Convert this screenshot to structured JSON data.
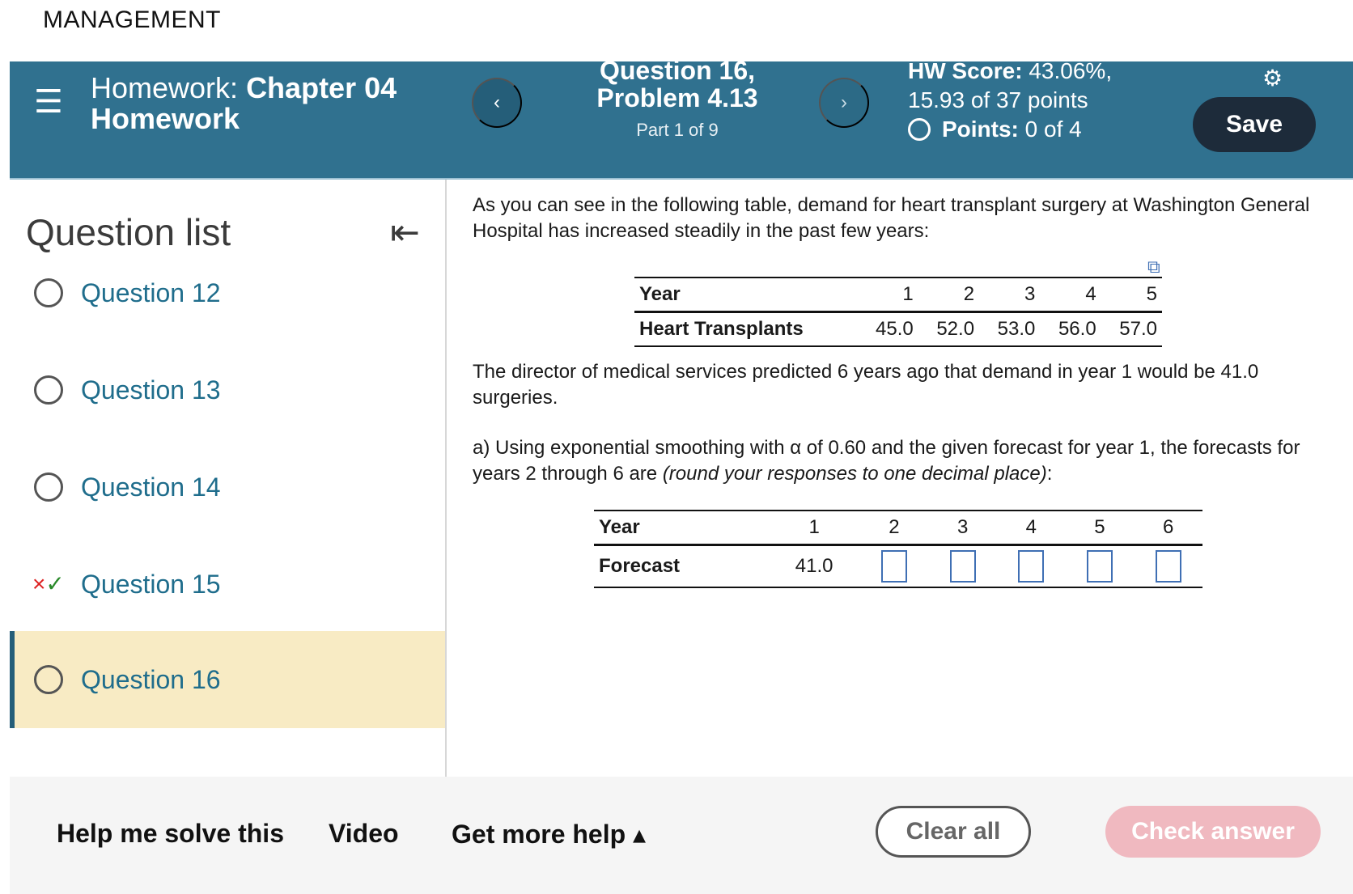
{
  "app": {
    "section_title": "MANAGEMENT"
  },
  "header": {
    "menu_icon": "hamburger-menu-icon",
    "hw_prefix": "Homework:",
    "hw_name_line1": "Chapter 04",
    "hw_name_line2": "Homework",
    "prev_label": "‹",
    "next_label": "›",
    "question_title_line1": "Question 16,",
    "question_title_line2": "Problem 4.13",
    "part": "Part 1 of 9",
    "hw_score_label": "HW Score:",
    "hw_score_value": "43.06%,",
    "hw_points": "15.93 of 37 points",
    "points_label": "Points:",
    "points_value": "0 of 4",
    "settings_icon": "gear-icon",
    "save_label": "Save"
  },
  "sidebar": {
    "title": "Question list",
    "collapse_icon": "collapse-left-icon",
    "items": [
      {
        "label": "Question 12",
        "status": "unanswered"
      },
      {
        "label": "Question 13",
        "status": "unanswered"
      },
      {
        "label": "Question 14",
        "status": "unanswered"
      },
      {
        "label": "Question 15",
        "status": "partial"
      },
      {
        "label": "Question 16",
        "status": "current"
      }
    ]
  },
  "question": {
    "intro": "As you can see in the following table, demand for heart transplant surgery at Washington General Hospital has increased steadily in the past few years:",
    "table1": {
      "row1_header": "Year",
      "years": [
        "1",
        "2",
        "3",
        "4",
        "5"
      ],
      "row2_header": "Heart Transplants",
      "values": [
        "45.0",
        "52.0",
        "53.0",
        "56.0",
        "57.0"
      ]
    },
    "director_text": "The director of medical services predicted 6 years ago that demand in year 1 would be 41.0 surgeries.",
    "part_a_text": "a) Using exponential smoothing with α of 0.60 and the given forecast for year 1, the forecasts for years 2 through 6 are ",
    "part_a_note": "(round your responses to one decimal place)",
    "part_a_end": ":",
    "table2": {
      "row1_header": "Year",
      "years": [
        "1",
        "2",
        "3",
        "4",
        "5",
        "6"
      ],
      "row2_header": "Forecast",
      "forecast_year1": "41.0"
    }
  },
  "footer": {
    "help_label": "Help me solve this",
    "video_label": "Video",
    "more_help_label": "Get more help ▴",
    "clear_label": "Clear all",
    "check_label": "Check answer"
  },
  "colors": {
    "header_bg": "#30718f",
    "link": "#1f6d8c",
    "current_row_bg": "#f8ebc4",
    "save_bg": "#1d2b3a",
    "check_bg": "#f0b9c0"
  }
}
